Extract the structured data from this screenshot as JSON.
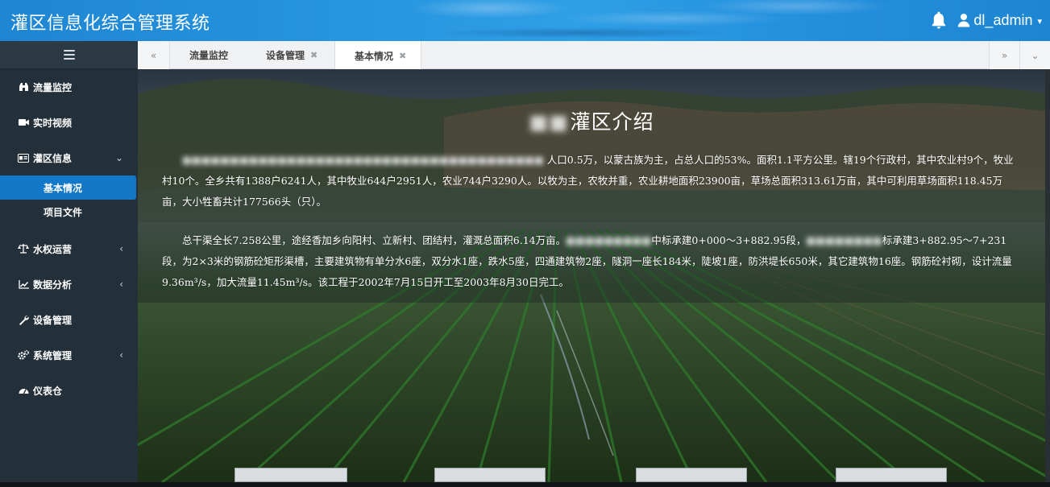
{
  "header": {
    "title": "灌区信息化综合管理系统",
    "username": "dl_admin",
    "icons": [
      "bell-icon",
      "user-icon",
      "caret-down-icon"
    ]
  },
  "sidebar": {
    "items": [
      {
        "label": "流量监控",
        "icon": "binoculars-icon"
      },
      {
        "label": "实时视频",
        "icon": "video-camera-icon"
      },
      {
        "label": "灌区信息",
        "icon": "id-card-icon",
        "expanded": true,
        "children": [
          {
            "label": "基本情况",
            "active": true
          },
          {
            "label": "项目文件"
          }
        ]
      },
      {
        "label": "水权运营",
        "icon": "balance-scale-icon"
      },
      {
        "label": "数据分析",
        "icon": "line-chart-icon"
      },
      {
        "label": "设备管理",
        "icon": "wrench-icon"
      },
      {
        "label": "系统管理",
        "icon": "gears-icon"
      },
      {
        "label": "仪表仓",
        "icon": "dashboard-icon"
      }
    ]
  },
  "tabs": [
    {
      "label": "流量监控",
      "closable": false
    },
    {
      "label": "设备管理",
      "closable": true
    },
    {
      "label": "基本情况",
      "closable": true,
      "active": true
    }
  ],
  "content": {
    "title": "灌区介绍",
    "para1_visible": "人口0.5万，以蒙古族为主，占总人口的53%。面积1.1平方公里。辖19个行政村，其中农业村9个，牧业村10个。全乡共有1388户6241人，其中牧业644户2951人，农业744户3290人。以牧为主，农牧并重，农业耕地面积23900亩，草场总面积313.61万亩，其中可利用草场面积118.45万亩，大小牲畜共计177566头（只）。",
    "para2_a": "总干渠全长7.258公里，途经香加乡向阳村、立新村、团结村，灌溉总面积6.14万亩。",
    "para2_b": "中标承建0+000～3+882.95段，",
    "para2_c": "标承建3+882.95～7+231段，为2×3米的钢筋砼矩形渠槽，主要建筑物有单分水6座，双分水1座，跌水5座，四通建筑物2座，隧洞一座长184米，陡坡1座，防洪堤长650米，其它建筑物16座。钢筋砼衬砌，设计流量9.36m³/s，加大流量11.45m³/s。该工程于2002年7月15日开工至2003年8月30日完工。"
  },
  "colors": {
    "header_blue": "#2795e0",
    "sidebar_bg": "#23303a",
    "active_item": "#1478c8"
  }
}
